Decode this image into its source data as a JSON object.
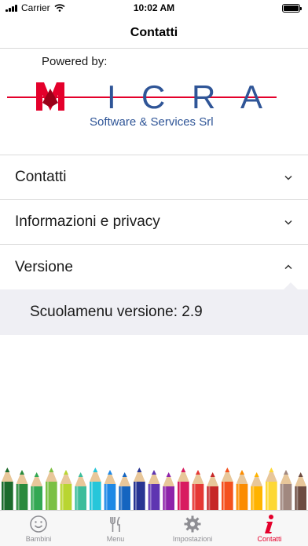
{
  "status_bar": {
    "carrier": "Carrier",
    "time": "10:02 AM",
    "battery_level": 1.0
  },
  "nav": {
    "title": "Contatti"
  },
  "logo": {
    "powered_by": "Powered by:",
    "letters": [
      "M",
      "I",
      "C",
      "R",
      "A"
    ],
    "subtitle": "Software & Services Srl",
    "colors": {
      "red": "#e4002b",
      "blue": "#2f5597"
    }
  },
  "menu": {
    "items": [
      {
        "label": "Contatti",
        "expanded": false,
        "icon": "chevron-down-icon"
      },
      {
        "label": "Informazioni e privacy",
        "expanded": false,
        "icon": "chevron-down-icon"
      },
      {
        "label": "Versione",
        "expanded": true,
        "icon": "chevron-up-icon"
      }
    ],
    "version_detail": "Scuolamenu versione: 2.9"
  },
  "pencil_colors": [
    "#1c6b2c",
    "#2a8a3c",
    "#34a853",
    "#7bc043",
    "#b9d531",
    "#3dbd9b",
    "#26c6da",
    "#1e88e5",
    "#1565c0",
    "#283593",
    "#5e35b1",
    "#8e24aa",
    "#d81b60",
    "#e53935",
    "#c62828",
    "#f4511e",
    "#fb8c00",
    "#ffb300",
    "#fdd835",
    "#a1887f",
    "#6d4c41"
  ],
  "tab_bar": {
    "tabs": [
      {
        "label": "Bambini",
        "icon": "smiley-face-icon",
        "active": false
      },
      {
        "label": "Menu",
        "icon": "fork-knife-icon",
        "active": false
      },
      {
        "label": "Impostazioni",
        "icon": "gear-icon",
        "active": false
      },
      {
        "label": "Contatti",
        "icon": "info-icon",
        "active": true
      }
    ]
  }
}
